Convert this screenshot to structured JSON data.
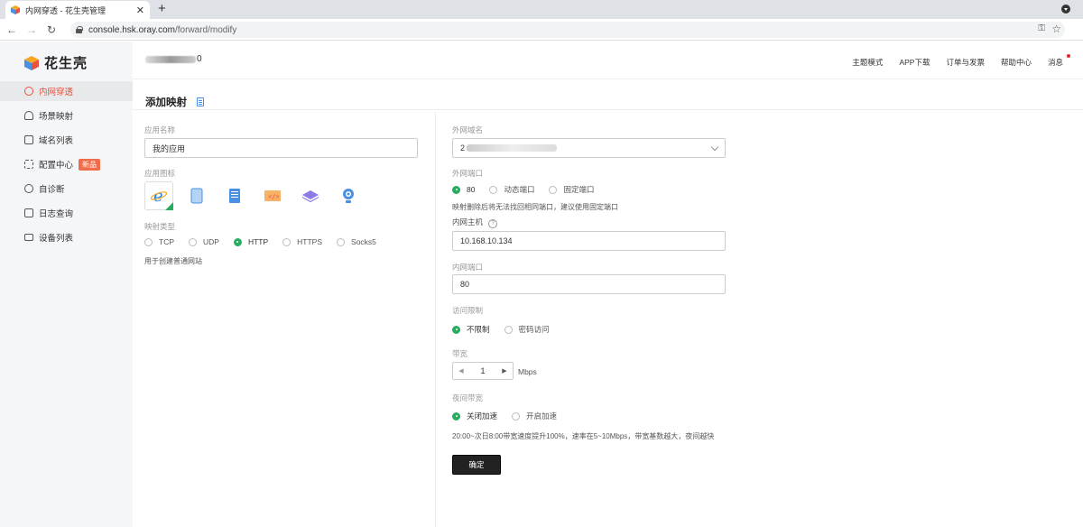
{
  "browser": {
    "tab_title": "内网穿透 - 花生壳管理",
    "tab_close": "✕",
    "new_tab": "+",
    "url_domain": "console.hsk.oray.com",
    "url_path": "/forward/modify"
  },
  "sidebar": {
    "logo_text": "花生壳",
    "items": [
      {
        "label": "内网穿透",
        "icon": "cube-icon",
        "active": true
      },
      {
        "label": "场景映射",
        "icon": "home-icon"
      },
      {
        "label": "域名列表",
        "icon": "domain-icon"
      },
      {
        "label": "配置中心",
        "icon": "grid-icon",
        "badge": "新品"
      },
      {
        "label": "自诊断",
        "icon": "diagnose-icon"
      },
      {
        "label": "日志查询",
        "icon": "log-icon"
      },
      {
        "label": "设备列表",
        "icon": "device-icon"
      }
    ]
  },
  "header": {
    "account_suffix": "0",
    "links": [
      "主题模式",
      "APP下载",
      "订单与发票",
      "帮助中心",
      "消息"
    ]
  },
  "page": {
    "title": "添加映射"
  },
  "form_left": {
    "app_name_label": "应用名称",
    "app_name_value": "我的应用",
    "app_icon_label": "应用图标",
    "mapping_type_label": "映射类型",
    "mapping_types": [
      "TCP",
      "UDP",
      "HTTP",
      "HTTPS",
      "Socks5"
    ],
    "mapping_type_selected": "HTTP",
    "mapping_hint": "用于创建普通网站"
  },
  "form_right": {
    "ext_domain_label": "外网域名",
    "ext_domain_prefix": "2",
    "ext_port_label": "外网端口",
    "ext_port_options": [
      "80",
      "动态端口",
      "固定端口"
    ],
    "ext_port_selected": "80",
    "ext_port_hint": "映射删除后将无法找回相同端口，建议使用固定端口",
    "int_host_label": "内网主机",
    "int_host_help": "?",
    "int_host_value": "10.168.10.134",
    "int_port_label": "内网端口",
    "int_port_value": "80",
    "access_label": "访问限制",
    "access_options": [
      "不限制",
      "密码访问"
    ],
    "access_selected": "不限制",
    "bandwidth_label": "带宽",
    "bandwidth_value": "1",
    "bandwidth_unit": "Mbps",
    "night_label": "夜间带宽",
    "night_options": [
      "关闭加速",
      "开启加速"
    ],
    "night_selected": "关闭加速",
    "night_hint": "20:00~次日8:00带宽速度提升100%，速率在5~10Mbps，带宽基数越大，夜间越快",
    "confirm_label": "确定"
  },
  "colors": {
    "accent_red": "#e8513b",
    "radio_green": "#27ad60",
    "button_dark": "#222222"
  }
}
